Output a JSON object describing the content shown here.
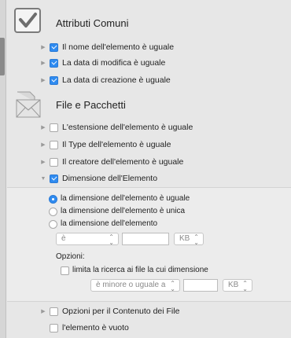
{
  "sections": {
    "common": {
      "title": "Attributi Comuni",
      "icon": "checkmark-icon",
      "items": [
        {
          "label": "Il nome dell'elemento è uguale",
          "checked": true
        },
        {
          "label": "La data di modifica è uguale",
          "checked": true
        },
        {
          "label": "La data di creazione è uguale",
          "checked": true
        }
      ]
    },
    "files": {
      "title": "File e Pacchetti",
      "icon": "envelope-file-icon",
      "items": [
        {
          "label": "L'estensione dell'elemento è uguale",
          "checked": false
        },
        {
          "label": "Il Type dell'elemento è uguale",
          "checked": false
        },
        {
          "label": "Il creatore dell'elemento è uguale",
          "checked": false
        },
        {
          "label": "Dimensione dell'Elemento",
          "checked": true,
          "expanded": true
        }
      ]
    },
    "size": {
      "radios": [
        {
          "label": "la dimensione dell'elemento è uguale",
          "selected": true
        },
        {
          "label": "la dimensione dell'elemento è unica",
          "selected": false
        },
        {
          "label": "la dimensione dell'elemento",
          "selected": false
        }
      ],
      "comparator_value": "è",
      "size_value": "",
      "unit_value": "KB",
      "options_label": "Opzioni:",
      "limit_checkbox_label": "limita la ricerca ai file la cui dimensione",
      "limit_checked": false,
      "limit_comparator_value": "è minore o uguale a",
      "limit_size_value": "",
      "limit_unit_value": "KB"
    },
    "content": {
      "items": [
        {
          "label": "Opzioni per il Contenuto dei File",
          "checked": false
        },
        {
          "label": "l'elemento è vuoto",
          "checked": false
        }
      ]
    }
  },
  "colors": {
    "accent": "#2f8bf0",
    "background": "#e7e7e7"
  }
}
